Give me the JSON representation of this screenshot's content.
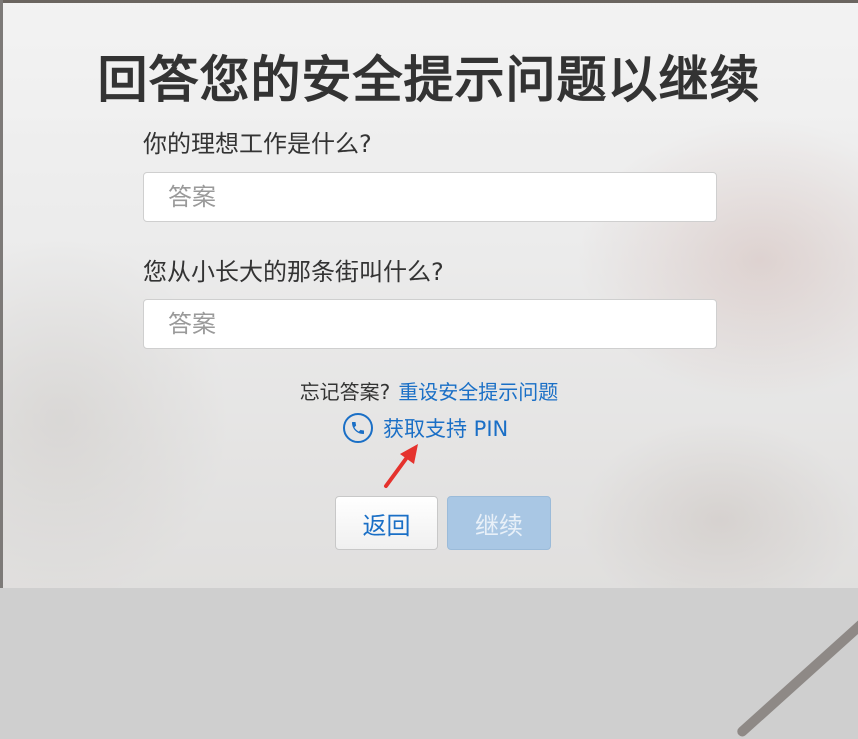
{
  "dialog": {
    "title": "回答您的安全提示问题以继续",
    "question1": "你的理想工作是什么?",
    "answer1_placeholder": "答案",
    "question2": "您从小长大的那条街叫什么?",
    "answer2_placeholder": "答案",
    "forgot_text": "忘记答案?",
    "reset_link": "重设安全提示问题",
    "support_link": "获取支持 PIN",
    "back_button": "返回",
    "continue_button": "继续"
  },
  "colors": {
    "link": "#1a6fc6",
    "continue_disabled_bg": "#a9c7e4",
    "annotation_arrow": "#e5322d"
  },
  "icons": [
    "phone-icon",
    "annotation-arrow-icon"
  ]
}
